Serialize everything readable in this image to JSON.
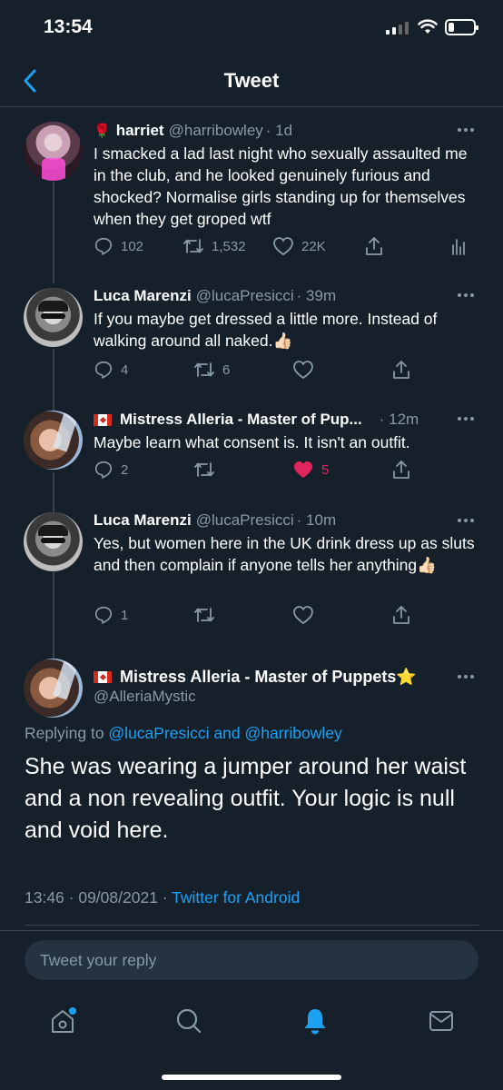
{
  "status_bar": {
    "time": "13:54"
  },
  "header": {
    "title": "Tweet"
  },
  "tweets": [
    {
      "emoji": "🌹",
      "name": "harriet",
      "handle": "@harribowley",
      "time": "· 1d",
      "text": "I smacked a lad last night who sexually assaulted me in the club, and he looked genuinely furious and shocked? Normalise girls standing up for themselves when they get groped wtf",
      "replies": "102",
      "retweets": "1,532",
      "likes": "22K"
    },
    {
      "name": "Luca Marenzi",
      "handle": "@lucaPresicci",
      "time": "· 39m",
      "text": "If you maybe get dressed a little more.  Instead of walking around all naked.👍🏻",
      "replies": "4",
      "retweets": "6",
      "likes": ""
    },
    {
      "name": "Mistress Alleria - Master of Pup...",
      "handle": "",
      "time": "· 12m",
      "text": "Maybe learn what consent is. It isn't an outfit.",
      "replies": "2",
      "retweets": "",
      "likes": "5"
    },
    {
      "name": "Luca Marenzi",
      "handle": "@lucaPresicci",
      "time": "· 10m",
      "text": "Yes, but women here in the UK drink dress up as sluts and then complain if anyone tells her anything👍🏻",
      "replies": "1",
      "retweets": "",
      "likes": ""
    }
  ],
  "focus": {
    "name": "Mistress Alleria - Master of Puppets⭐",
    "handle": "@AlleriaMystic",
    "replying_prefix": "Replying to ",
    "replying_user1": "@lucaPresicci",
    "replying_and": " and ",
    "replying_user2": "@harribowley",
    "text": "She was wearing a jumper around her waist and a non revealing outfit. Your logic is null and void here.",
    "timestamp": "13:46 · 09/08/2021 · ",
    "client": "Twitter for Android"
  },
  "composer": {
    "placeholder": "Tweet your reply"
  },
  "colors": {
    "background": "#15202b",
    "accent": "#1da1f2",
    "like": "#e0245e",
    "muted": "#8899a6"
  },
  "tabs": [
    "home-icon",
    "search-icon",
    "notifications-icon",
    "messages-icon"
  ]
}
